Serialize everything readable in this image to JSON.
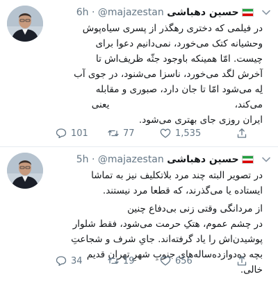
{
  "tweets": [
    {
      "author_name": "حسین دهباشی",
      "handle": "@majazestan",
      "dot": "·",
      "time": "6h",
      "lines": [
        "در فیلمی که دختری رهگذر از پسری سیاه‌پوش",
        "وحشیانه کتک می‌خورد، نمی‌دانیم دعوا برای",
        "چیست. امّا همینکه باوجود جثّه ظریف‌اش تا",
        "آخرش لگد می‌خورد، ناسزا می‌شنود، در جوی آب",
        "لِه می‌شود امّا تا جان دارد، صبوری و مقابله",
        "می‌کند،                                          یعنی",
        "ایران روزی جای بهتری می‌شود."
      ],
      "replies": "101",
      "retweets": "77",
      "likes": "1,535"
    },
    {
      "author_name": "حسین دهباشی",
      "handle": "@majazestan",
      "dot": "·",
      "time": "5h",
      "lines": [
        "در تصویر البته چند مرد بلاتکلیف نیز به تماشا",
        "ایستاده یا می‌گذرند، که قطعا مرد نیستند.",
        "از مردانگی وقتی زنی بی‌دفاع چنین",
        "در چشم عموم، هتکِ حرمت می‌شود، فقط شلوار",
        "پوشیدن‌اش را یاد گرفته‌اند. جایِ شرف و شجاعتِ",
        "بچه ده‌دوازده‌ساله‌های جنوبِ شهرِ تهران قدیم",
        "خالی."
      ],
      "replies": "34",
      "retweets": "19",
      "likes": "656"
    }
  ],
  "colors": {
    "text": "#14171a",
    "muted": "#657786",
    "divider": "#e6ecf0"
  },
  "icons": [
    "chevron-down-icon",
    "reply-icon",
    "retweet-icon",
    "like-icon",
    "share-icon",
    "iran-flag-icon"
  ]
}
